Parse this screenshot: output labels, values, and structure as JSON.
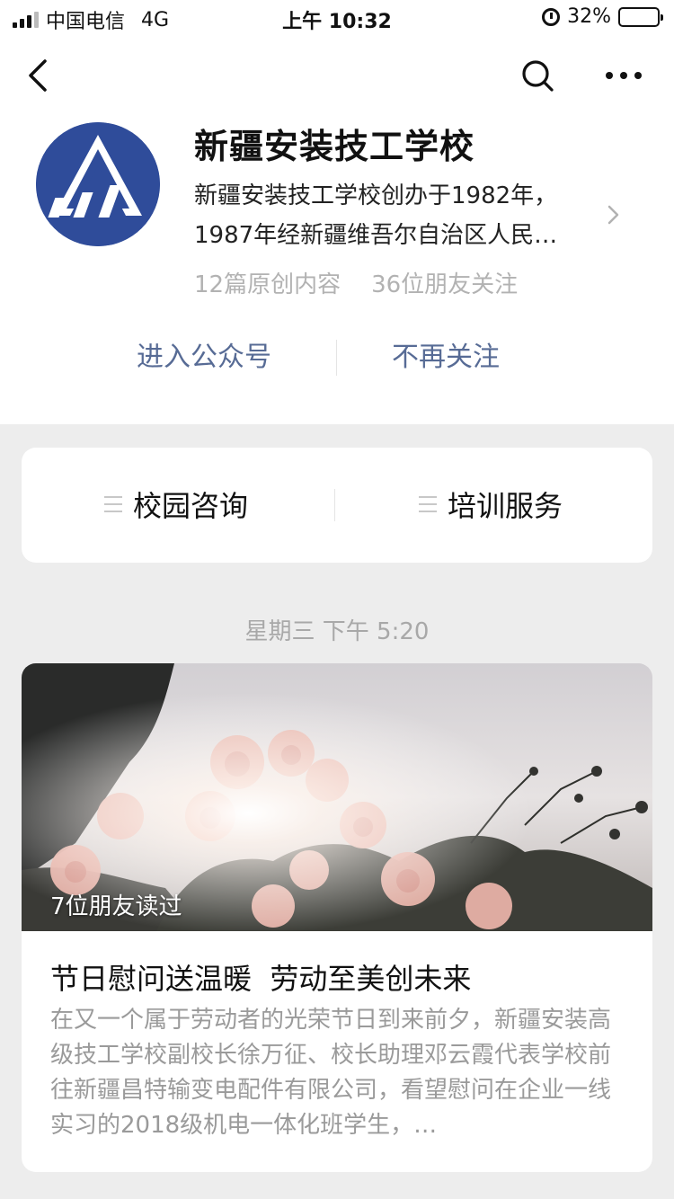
{
  "status_bar": {
    "carrier": "中国电信",
    "network": "4G",
    "time": "上午 10:32",
    "battery": "32%",
    "battery_level": 0.32
  },
  "account": {
    "name": "新疆安装技工学校",
    "description": "新疆安装技工学校创办于1982年，1987年经新疆维吾尔自治区人民…",
    "original_count": "12篇原创内容",
    "followers": "36位朋友关注"
  },
  "actions": {
    "enter": "进入公众号",
    "unfollow": "不再关注"
  },
  "menu": {
    "items": [
      {
        "label": "校园咨询"
      },
      {
        "label": "培训服务"
      }
    ]
  },
  "feed": {
    "date": "星期三 下午 5:20",
    "article": {
      "read_badge": "7位朋友读过",
      "title": "节日慰问送温暖  劳动至美创未来",
      "summary": "在又一个属于劳动者的光荣节日到来前夕，新疆安装高级技工学校副校长徐万征、校长助理邓云霞代表学校前往新疆昌特输变电配件有限公司，看望慰问在企业一线实习的2018级机电一体化班学生，…"
    }
  },
  "colors": {
    "link_blue": "#576b95",
    "logo_blue": "#2f4c9a",
    "page_bg": "#ededed"
  }
}
